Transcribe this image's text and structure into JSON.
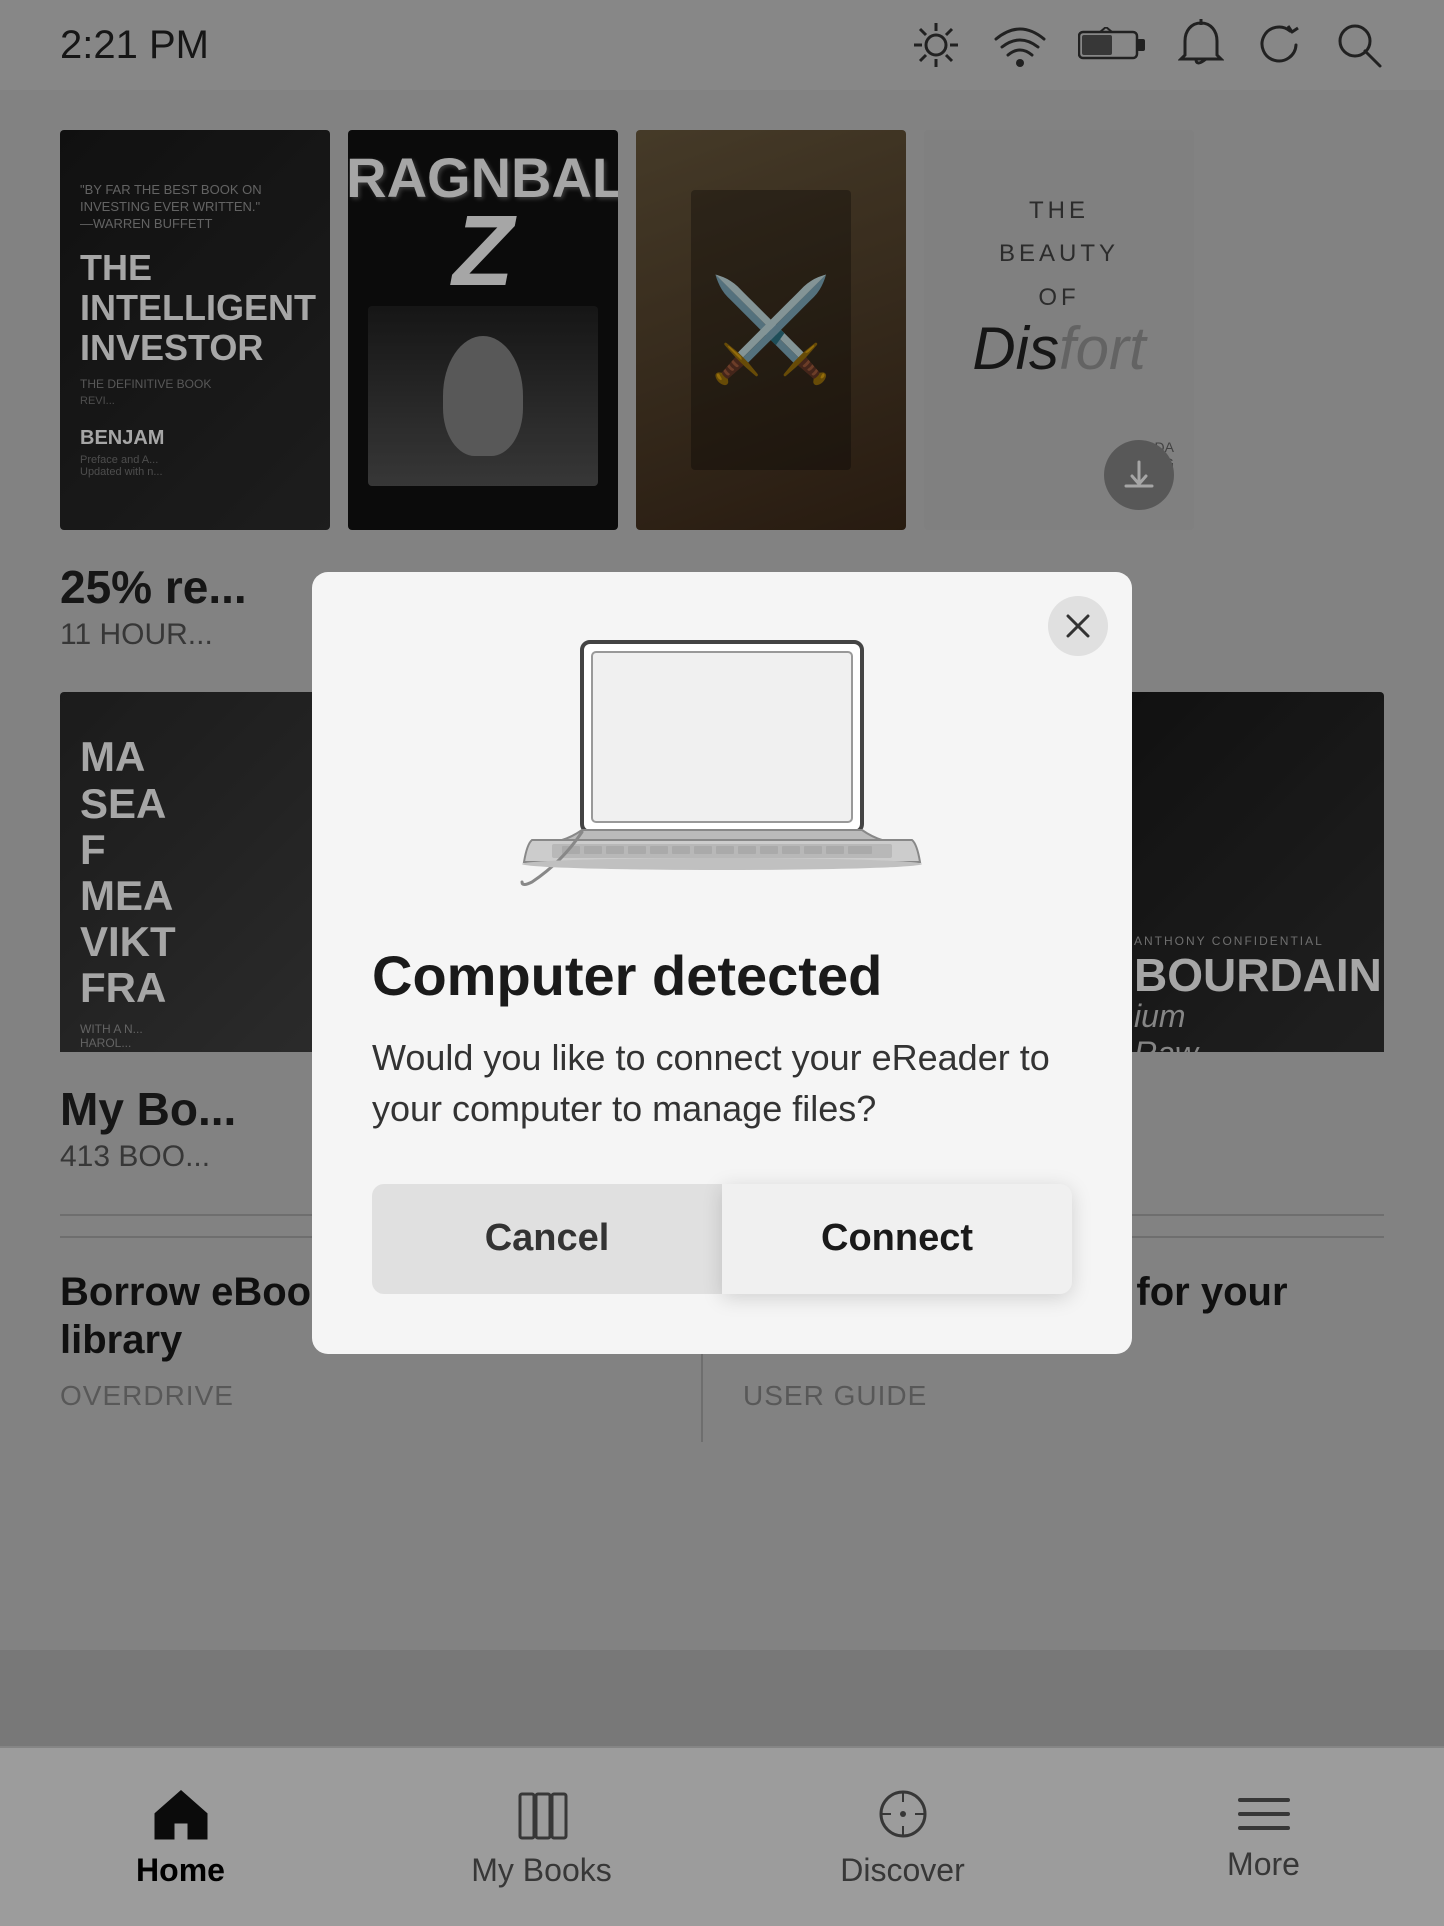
{
  "statusBar": {
    "time": "2:21 PM",
    "icons": [
      "brightness-icon",
      "wifi-icon",
      "battery-icon",
      "notification-icon",
      "sync-icon",
      "search-icon"
    ]
  },
  "bookShelf1": {
    "books": [
      {
        "id": "intelligent-investor",
        "quote": "\"BY FAR THE BEST BOOK ON INVESTING EVER WRITTEN.\" —WARREN BUFFETT",
        "title": "THE\nINTELLIGENT\nINVESTOR",
        "subtitle": "THE DEFINITIVE BOOK",
        "author": "BENJAM"
      },
      {
        "id": "dragonball",
        "title": "DRAGON BALL",
        "sub": "Z"
      },
      {
        "id": "manga-3",
        "title": ""
      },
      {
        "id": "beauty-of-discomfort",
        "line1": "THE",
        "line2": "BEAUTY",
        "line3": "OF",
        "main": "Dis fort"
      }
    ]
  },
  "bookInfo1": {
    "title": "25% re...",
    "sub": "11 HOUR..."
  },
  "bookShelf2": {
    "books": [
      {
        "id": "mans-search",
        "lines": [
          "MA",
          "SEA",
          "F",
          "MEA",
          "VIKT",
          "FRA"
        ]
      },
      {
        "id": "anime-book",
        "title": ""
      },
      {
        "id": "bourdain",
        "name": "BOURDAIN",
        "title1": "ium",
        "title2": "Raw"
      }
    ]
  },
  "bookInfo2": {
    "title": "My Bo...",
    "sub": "413 BOO..."
  },
  "links": [
    {
      "title": "Borrow eBooks from your public library",
      "sub": "OVERDRIVE"
    },
    {
      "title": "Read the user guide for your Kobo Forma",
      "sub": "USER GUIDE"
    }
  ],
  "bottomNav": {
    "items": [
      {
        "id": "home",
        "icon": "🏠",
        "label": "Home",
        "active": true
      },
      {
        "id": "my-books",
        "icon": "📚",
        "label": "My Books",
        "active": false
      },
      {
        "id": "discover",
        "icon": "🧭",
        "label": "Discover",
        "active": false
      },
      {
        "id": "more",
        "icon": "☰",
        "label": "More",
        "active": false
      }
    ]
  },
  "modal": {
    "title": "Computer detected",
    "body": "Would you like to connect your eReader to your computer to manage files?",
    "cancelLabel": "Cancel",
    "connectLabel": "Connect",
    "closeLabel": "×"
  }
}
